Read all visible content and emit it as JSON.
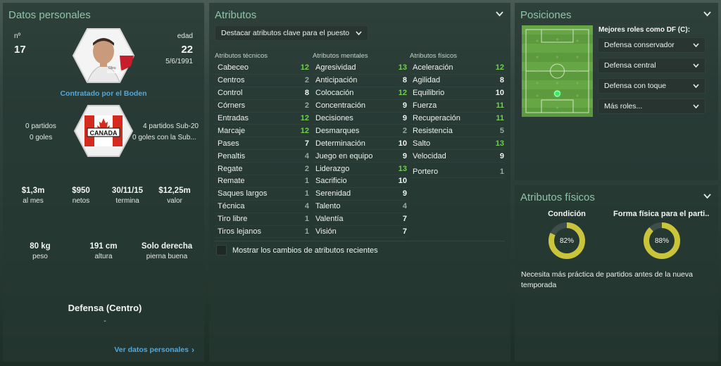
{
  "personal": {
    "title": "Datos personales",
    "number_label": "nº",
    "number": "17",
    "age_label": "edad",
    "age": "22",
    "dob": "5/6/1991",
    "photo_name": "MAURO",
    "photo_sub": "Oleu",
    "contract": "Contratado por el Boden",
    "flag_text": "CANADA",
    "left_matches": "0 partidos",
    "left_goals": "0 goles",
    "right_matches": "4 partidos Sub-20",
    "right_goals": "0 goles con la Sub...",
    "stats": [
      {
        "value": "$1,3m",
        "label": "al mes"
      },
      {
        "value": "$950",
        "label": "netos"
      },
      {
        "value": "30/11/15",
        "label": "termina"
      },
      {
        "value": "$12,25m",
        "label": "valor"
      }
    ],
    "physical": [
      {
        "value": "80 kg",
        "label": "peso"
      },
      {
        "value": "191 cm",
        "label": "altura"
      },
      {
        "value": "Solo derecha",
        "label": "pierna buena"
      }
    ],
    "position": "Defensa (Centro)",
    "position_sub": "-",
    "link": "Ver datos personales"
  },
  "attributes": {
    "title": "Atributos",
    "highlight_select": "Destacar atributos clave para el puesto",
    "checkbox_label": "Mostrar los cambios de atributos recientes",
    "columns": [
      {
        "header": "Atributos técnicos",
        "rows": [
          {
            "name": "Cabeceo",
            "value": "12",
            "tone": "green"
          },
          {
            "name": "Centros",
            "value": "2",
            "tone": "grey"
          },
          {
            "name": "Control",
            "value": "8",
            "tone": "white"
          },
          {
            "name": "Córners",
            "value": "2",
            "tone": "grey"
          },
          {
            "name": "Entradas",
            "value": "12",
            "tone": "green"
          },
          {
            "name": "Marcaje",
            "value": "12",
            "tone": "green"
          },
          {
            "name": "Pases",
            "value": "7",
            "tone": "white"
          },
          {
            "name": "Penaltis",
            "value": "4",
            "tone": "grey"
          },
          {
            "name": "Regate",
            "value": "2",
            "tone": "grey"
          },
          {
            "name": "Remate",
            "value": "1",
            "tone": "grey"
          },
          {
            "name": "Saques largos",
            "value": "1",
            "tone": "grey"
          },
          {
            "name": "Técnica",
            "value": "4",
            "tone": "grey"
          },
          {
            "name": "Tiro libre",
            "value": "1",
            "tone": "grey"
          },
          {
            "name": "Tiros lejanos",
            "value": "1",
            "tone": "grey"
          }
        ]
      },
      {
        "header": "Atributos mentales",
        "rows": [
          {
            "name": "Agresividad",
            "value": "13",
            "tone": "green"
          },
          {
            "name": "Anticipación",
            "value": "8",
            "tone": "white"
          },
          {
            "name": "Colocación",
            "value": "12",
            "tone": "green"
          },
          {
            "name": "Concentración",
            "value": "9",
            "tone": "white"
          },
          {
            "name": "Decisiones",
            "value": "9",
            "tone": "white"
          },
          {
            "name": "Desmarques",
            "value": "2",
            "tone": "grey"
          },
          {
            "name": "Determinación",
            "value": "10",
            "tone": "white"
          },
          {
            "name": "Juego en equipo",
            "value": "9",
            "tone": "white"
          },
          {
            "name": "Liderazgo",
            "value": "13",
            "tone": "green"
          },
          {
            "name": "Sacrificio",
            "value": "10",
            "tone": "white"
          },
          {
            "name": "Serenidad",
            "value": "9",
            "tone": "white"
          },
          {
            "name": "Talento",
            "value": "4",
            "tone": "grey"
          },
          {
            "name": "Valentía",
            "value": "7",
            "tone": "white"
          },
          {
            "name": "Visión",
            "value": "7",
            "tone": "white"
          }
        ]
      },
      {
        "header": "Atributos físicos",
        "rows": [
          {
            "name": "Aceleración",
            "value": "12",
            "tone": "green"
          },
          {
            "name": "Agilidad",
            "value": "8",
            "tone": "white"
          },
          {
            "name": "Equilibrio",
            "value": "10",
            "tone": "white"
          },
          {
            "name": "Fuerza",
            "value": "11",
            "tone": "green"
          },
          {
            "name": "Recuperación",
            "value": "11",
            "tone": "green"
          },
          {
            "name": "Resistencia",
            "value": "5",
            "tone": "grey"
          },
          {
            "name": "Salto",
            "value": "13",
            "tone": "green"
          },
          {
            "name": "Velocidad",
            "value": "9",
            "tone": "white"
          },
          {
            "name": "Portero",
            "value": "1",
            "tone": "grey"
          }
        ]
      }
    ]
  },
  "positions": {
    "title": "Posiciones",
    "roles_header": "Mejores roles como DF (C):",
    "roles": [
      "Defensa conservador",
      "Defensa central",
      "Defensa con toque",
      "Más roles..."
    ]
  },
  "fitness": {
    "title": "Atributos físicos",
    "condition_label": "Condición",
    "condition_value": "82%",
    "condition_fraction": 0.82,
    "form_label": "Forma física para el parti...",
    "form_value": "88%",
    "form_fraction": 0.88,
    "note": "Necesita más práctica de partidos antes de la nueva temporada",
    "ring_color": "#c9c43a"
  }
}
